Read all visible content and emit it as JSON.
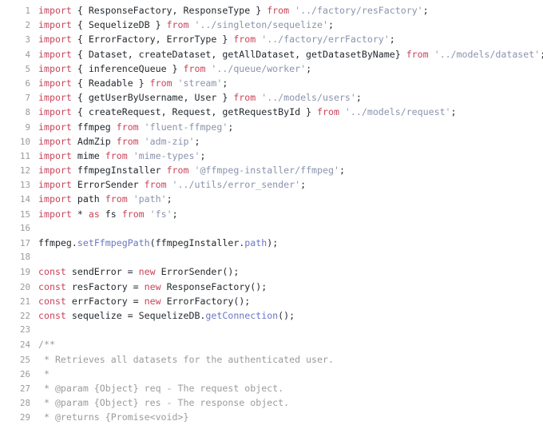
{
  "editor": {
    "language": "typescript",
    "background_color": "#ffffff",
    "line_number_color": "#9a9a9a",
    "colors": {
      "keyword": "#c9445a",
      "string": "#8a93ad",
      "method": "#6b76c4",
      "comment": "#9b9b9b",
      "plain": "#24292e"
    },
    "first_line_number": 1,
    "last_line_number": 29,
    "lines": [
      {
        "number": "1",
        "tokens": [
          {
            "t": "import",
            "c": "keyword"
          },
          {
            "t": " { ResponseFactory, ResponseType } ",
            "c": "plain"
          },
          {
            "t": "from",
            "c": "keyword"
          },
          {
            "t": " ",
            "c": "plain"
          },
          {
            "t": "'../factory/resFactory'",
            "c": "string"
          },
          {
            "t": ";",
            "c": "plain"
          }
        ]
      },
      {
        "number": "2",
        "tokens": [
          {
            "t": "import",
            "c": "keyword"
          },
          {
            "t": " { SequelizeDB } ",
            "c": "plain"
          },
          {
            "t": "from",
            "c": "keyword"
          },
          {
            "t": " ",
            "c": "plain"
          },
          {
            "t": "'../singleton/sequelize'",
            "c": "string"
          },
          {
            "t": ";",
            "c": "plain"
          }
        ]
      },
      {
        "number": "3",
        "tokens": [
          {
            "t": "import",
            "c": "keyword"
          },
          {
            "t": " { ErrorFactory, ErrorType } ",
            "c": "plain"
          },
          {
            "t": "from",
            "c": "keyword"
          },
          {
            "t": " ",
            "c": "plain"
          },
          {
            "t": "'../factory/errFactory'",
            "c": "string"
          },
          {
            "t": ";",
            "c": "plain"
          }
        ]
      },
      {
        "number": "4",
        "tokens": [
          {
            "t": "import",
            "c": "keyword"
          },
          {
            "t": " { Dataset, createDataset, getAllDataset, getDatasetByName} ",
            "c": "plain"
          },
          {
            "t": "from",
            "c": "keyword"
          },
          {
            "t": " ",
            "c": "plain"
          },
          {
            "t": "'../models/dataset'",
            "c": "string"
          },
          {
            "t": ";",
            "c": "plain"
          }
        ]
      },
      {
        "number": "5",
        "tokens": [
          {
            "t": "import",
            "c": "keyword"
          },
          {
            "t": " { inferenceQueue } ",
            "c": "plain"
          },
          {
            "t": "from",
            "c": "keyword"
          },
          {
            "t": " ",
            "c": "plain"
          },
          {
            "t": "'../queue/worker'",
            "c": "string"
          },
          {
            "t": ";",
            "c": "plain"
          }
        ]
      },
      {
        "number": "6",
        "tokens": [
          {
            "t": "import",
            "c": "keyword"
          },
          {
            "t": " { Readable } ",
            "c": "plain"
          },
          {
            "t": "from",
            "c": "keyword"
          },
          {
            "t": " ",
            "c": "plain"
          },
          {
            "t": "'stream'",
            "c": "string"
          },
          {
            "t": ";",
            "c": "plain"
          }
        ]
      },
      {
        "number": "7",
        "tokens": [
          {
            "t": "import",
            "c": "keyword"
          },
          {
            "t": " { getUserByUsername, User } ",
            "c": "plain"
          },
          {
            "t": "from",
            "c": "keyword"
          },
          {
            "t": " ",
            "c": "plain"
          },
          {
            "t": "'../models/users'",
            "c": "string"
          },
          {
            "t": ";",
            "c": "plain"
          }
        ]
      },
      {
        "number": "8",
        "tokens": [
          {
            "t": "import",
            "c": "keyword"
          },
          {
            "t": " { createRequest, Request, getRequestById } ",
            "c": "plain"
          },
          {
            "t": "from",
            "c": "keyword"
          },
          {
            "t": " ",
            "c": "plain"
          },
          {
            "t": "'../models/request'",
            "c": "string"
          },
          {
            "t": ";",
            "c": "plain"
          }
        ]
      },
      {
        "number": "9",
        "tokens": [
          {
            "t": "import",
            "c": "keyword"
          },
          {
            "t": " ffmpeg ",
            "c": "plain"
          },
          {
            "t": "from",
            "c": "keyword"
          },
          {
            "t": " ",
            "c": "plain"
          },
          {
            "t": "'fluent-ffmpeg'",
            "c": "string"
          },
          {
            "t": ";",
            "c": "plain"
          }
        ]
      },
      {
        "number": "10",
        "tokens": [
          {
            "t": "import",
            "c": "keyword"
          },
          {
            "t": " AdmZip ",
            "c": "plain"
          },
          {
            "t": "from",
            "c": "keyword"
          },
          {
            "t": " ",
            "c": "plain"
          },
          {
            "t": "'adm-zip'",
            "c": "string"
          },
          {
            "t": ";",
            "c": "plain"
          }
        ]
      },
      {
        "number": "11",
        "tokens": [
          {
            "t": "import",
            "c": "keyword"
          },
          {
            "t": " mime ",
            "c": "plain"
          },
          {
            "t": "from",
            "c": "keyword"
          },
          {
            "t": " ",
            "c": "plain"
          },
          {
            "t": "'mime-types'",
            "c": "string"
          },
          {
            "t": ";",
            "c": "plain"
          }
        ]
      },
      {
        "number": "12",
        "tokens": [
          {
            "t": "import",
            "c": "keyword"
          },
          {
            "t": " ffmpegInstaller ",
            "c": "plain"
          },
          {
            "t": "from",
            "c": "keyword"
          },
          {
            "t": " ",
            "c": "plain"
          },
          {
            "t": "'@ffmpeg-installer/ffmpeg'",
            "c": "string"
          },
          {
            "t": ";",
            "c": "plain"
          }
        ]
      },
      {
        "number": "13",
        "tokens": [
          {
            "t": "import",
            "c": "keyword"
          },
          {
            "t": " ErrorSender ",
            "c": "plain"
          },
          {
            "t": "from",
            "c": "keyword"
          },
          {
            "t": " ",
            "c": "plain"
          },
          {
            "t": "'../utils/error_sender'",
            "c": "string"
          },
          {
            "t": ";",
            "c": "plain"
          }
        ]
      },
      {
        "number": "14",
        "tokens": [
          {
            "t": "import",
            "c": "keyword"
          },
          {
            "t": " path ",
            "c": "plain"
          },
          {
            "t": "from",
            "c": "keyword"
          },
          {
            "t": " ",
            "c": "plain"
          },
          {
            "t": "'path'",
            "c": "string"
          },
          {
            "t": ";",
            "c": "plain"
          }
        ]
      },
      {
        "number": "15",
        "tokens": [
          {
            "t": "import",
            "c": "keyword"
          },
          {
            "t": " * ",
            "c": "plain"
          },
          {
            "t": "as",
            "c": "keyword"
          },
          {
            "t": " fs ",
            "c": "plain"
          },
          {
            "t": "from",
            "c": "keyword"
          },
          {
            "t": " ",
            "c": "plain"
          },
          {
            "t": "'fs'",
            "c": "string"
          },
          {
            "t": ";",
            "c": "plain"
          }
        ]
      },
      {
        "number": "16",
        "tokens": []
      },
      {
        "number": "17",
        "tokens": [
          {
            "t": "ffmpeg.",
            "c": "plain"
          },
          {
            "t": "setFfmpegPath",
            "c": "method"
          },
          {
            "t": "(ffmpegInstaller.",
            "c": "plain"
          },
          {
            "t": "path",
            "c": "method"
          },
          {
            "t": ");",
            "c": "plain"
          }
        ]
      },
      {
        "number": "18",
        "tokens": []
      },
      {
        "number": "19",
        "tokens": [
          {
            "t": "const",
            "c": "keyword"
          },
          {
            "t": " sendError = ",
            "c": "plain"
          },
          {
            "t": "new",
            "c": "keyword"
          },
          {
            "t": " ErrorSender();",
            "c": "plain"
          }
        ]
      },
      {
        "number": "20",
        "tokens": [
          {
            "t": "const",
            "c": "keyword"
          },
          {
            "t": " resFactory = ",
            "c": "plain"
          },
          {
            "t": "new",
            "c": "keyword"
          },
          {
            "t": " ResponseFactory();",
            "c": "plain"
          }
        ]
      },
      {
        "number": "21",
        "tokens": [
          {
            "t": "const",
            "c": "keyword"
          },
          {
            "t": " errFactory = ",
            "c": "plain"
          },
          {
            "t": "new",
            "c": "keyword"
          },
          {
            "t": " ErrorFactory();",
            "c": "plain"
          }
        ]
      },
      {
        "number": "22",
        "tokens": [
          {
            "t": "const",
            "c": "keyword"
          },
          {
            "t": " sequelize = SequelizeDB.",
            "c": "plain"
          },
          {
            "t": "getConnection",
            "c": "method"
          },
          {
            "t": "();",
            "c": "plain"
          }
        ]
      },
      {
        "number": "23",
        "tokens": []
      },
      {
        "number": "24",
        "tokens": [
          {
            "t": "/**",
            "c": "comment"
          }
        ]
      },
      {
        "number": "25",
        "tokens": [
          {
            "t": " * Retrieves all datasets for the authenticated user.",
            "c": "comment"
          }
        ]
      },
      {
        "number": "26",
        "tokens": [
          {
            "t": " *",
            "c": "comment"
          }
        ]
      },
      {
        "number": "27",
        "tokens": [
          {
            "t": " * @param {Object} req - The request object.",
            "c": "comment"
          }
        ]
      },
      {
        "number": "28",
        "tokens": [
          {
            "t": " * @param {Object} res - The response object.",
            "c": "comment"
          }
        ]
      },
      {
        "number": "29",
        "tokens": [
          {
            "t": " * @returns {Promise<void>}",
            "c": "comment"
          }
        ]
      }
    ]
  }
}
